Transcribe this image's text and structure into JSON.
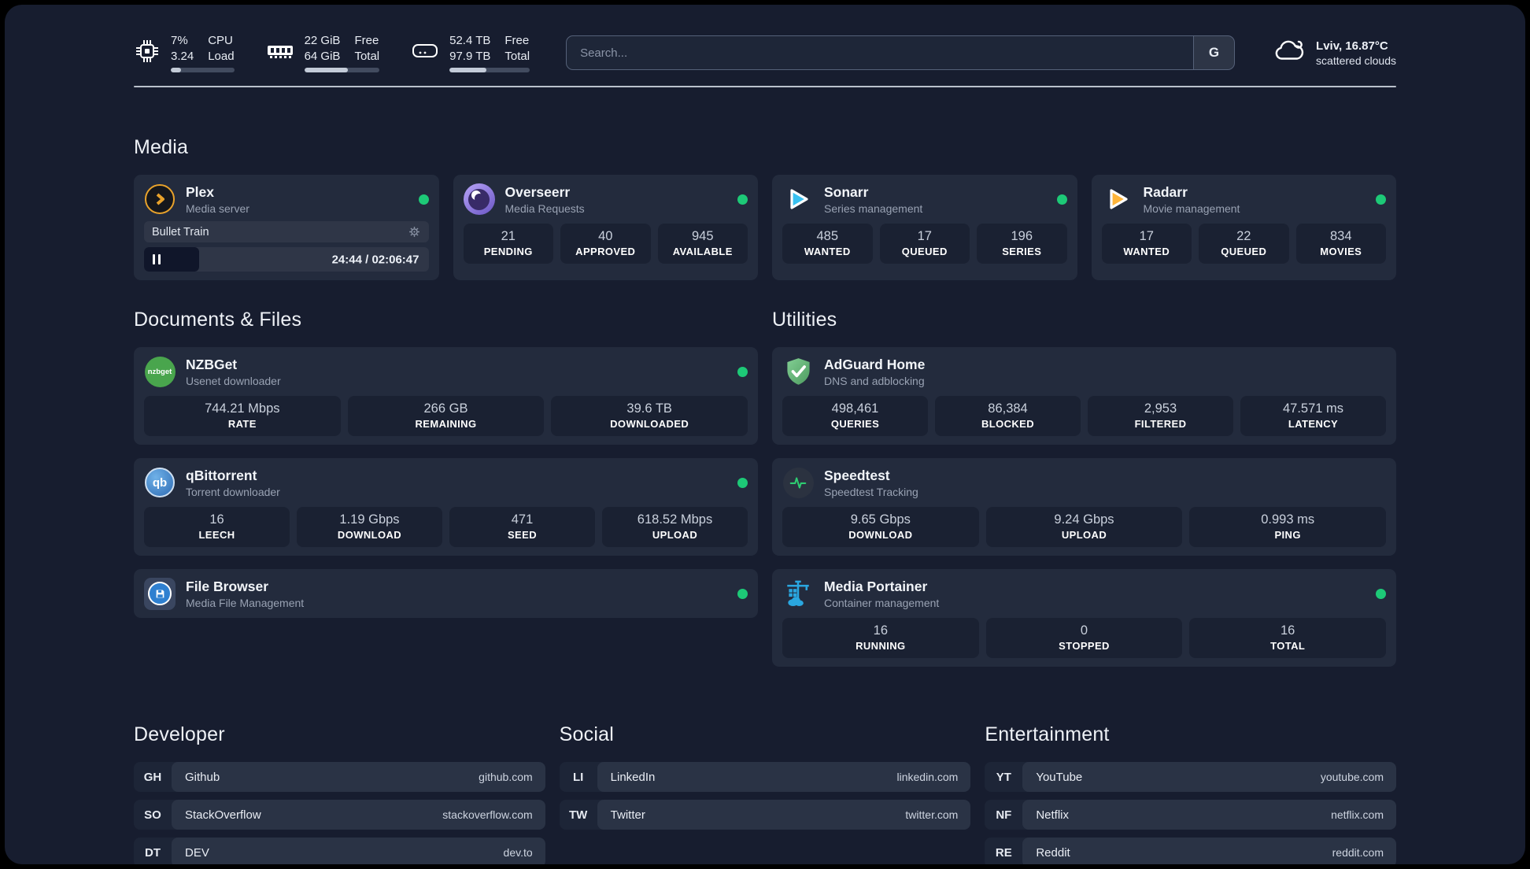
{
  "colors": {
    "page_bg": "#171d2f",
    "card_bg": "#232b3d",
    "tile_bg": "#1a2132",
    "status_green": "#1dc977",
    "plex_orange": "#e8a22b",
    "portainer_blue": "#2aa7e0"
  },
  "header": {
    "stats": [
      {
        "icon": "cpu-icon",
        "col1": [
          "7%",
          "3.24"
        ],
        "col2": [
          "CPU",
          "Load"
        ],
        "progress_pct": 16
      },
      {
        "icon": "ram-icon",
        "col1": [
          "22 GiB",
          "64 GiB"
        ],
        "col2": [
          "Free",
          "Total"
        ],
        "progress_pct": 58
      },
      {
        "icon": "disk-icon",
        "col1": [
          "52.4 TB",
          "97.9 TB"
        ],
        "col2": [
          "Free",
          "Total"
        ],
        "progress_pct": 46
      }
    ],
    "search": {
      "placeholder": "Search...",
      "button_label": "G"
    },
    "weather": {
      "icon": "cloud-icon",
      "line1": "Lviv, 16.87°C",
      "line2": "scattered clouds"
    }
  },
  "media": {
    "title": "Media",
    "plex": {
      "icon": "plex-icon",
      "name": "Plex",
      "desc": "Media server",
      "status": "online",
      "now_playing": {
        "title": "Bullet Train",
        "time": "24:44 / 02:06:47",
        "progress_pct": 19.5,
        "state": "paused"
      }
    },
    "overseerr": {
      "icon": "overseerr-icon",
      "name": "Overseerr",
      "desc": "Media Requests",
      "status": "online",
      "stats": [
        {
          "value": "21",
          "label": "PENDING"
        },
        {
          "value": "40",
          "label": "APPROVED"
        },
        {
          "value": "945",
          "label": "AVAILABLE"
        }
      ]
    },
    "sonarr": {
      "icon": "sonarr-icon",
      "name": "Sonarr",
      "desc": "Series management",
      "status": "online",
      "stats": [
        {
          "value": "485",
          "label": "WANTED"
        },
        {
          "value": "17",
          "label": "QUEUED"
        },
        {
          "value": "196",
          "label": "SERIES"
        }
      ]
    },
    "radarr": {
      "icon": "radarr-icon",
      "name": "Radarr",
      "desc": "Movie management",
      "status": "online",
      "stats": [
        {
          "value": "17",
          "label": "WANTED"
        },
        {
          "value": "22",
          "label": "QUEUED"
        },
        {
          "value": "834",
          "label": "MOVIES"
        }
      ]
    }
  },
  "documents": {
    "title": "Documents & Files",
    "nzbget": {
      "icon": "nzbget-icon",
      "name": "NZBGet",
      "desc": "Usenet downloader",
      "status": "online",
      "stats": [
        {
          "value": "744.21 Mbps",
          "label": "RATE"
        },
        {
          "value": "266 GB",
          "label": "REMAINING"
        },
        {
          "value": "39.6 TB",
          "label": "DOWNLOADED"
        }
      ]
    },
    "qbittorrent": {
      "icon": "qbittorrent-icon",
      "name": "qBittorrent",
      "desc": "Torrent downloader",
      "status": "online",
      "stats": [
        {
          "value": "16",
          "label": "LEECH"
        },
        {
          "value": "1.19 Gbps",
          "label": "DOWNLOAD"
        },
        {
          "value": "471",
          "label": "SEED"
        },
        {
          "value": "618.52 Mbps",
          "label": "UPLOAD"
        }
      ]
    },
    "filebrowser": {
      "icon": "filebrowser-icon",
      "name": "File Browser",
      "desc": "Media File Management",
      "status": "online"
    }
  },
  "utilities": {
    "title": "Utilities",
    "adguard": {
      "icon": "adguard-icon",
      "name": "AdGuard Home",
      "desc": "DNS and adblocking",
      "stats": [
        {
          "value": "498,461",
          "label": "QUERIES"
        },
        {
          "value": "86,384",
          "label": "BLOCKED"
        },
        {
          "value": "2,953",
          "label": "FILTERED"
        },
        {
          "value": "47.571 ms",
          "label": "LATENCY"
        }
      ]
    },
    "speedtest": {
      "icon": "speedtest-icon",
      "name": "Speedtest",
      "desc": "Speedtest Tracking",
      "stats": [
        {
          "value": "9.65 Gbps",
          "label": "DOWNLOAD"
        },
        {
          "value": "9.24 Gbps",
          "label": "UPLOAD"
        },
        {
          "value": "0.993 ms",
          "label": "PING"
        }
      ]
    },
    "portainer": {
      "icon": "portainer-icon",
      "name": "Media Portainer",
      "desc": "Container management",
      "status": "online",
      "stats": [
        {
          "value": "16",
          "label": "RUNNING"
        },
        {
          "value": "0",
          "label": "STOPPED"
        },
        {
          "value": "16",
          "label": "TOTAL"
        }
      ]
    }
  },
  "links": {
    "developer": {
      "title": "Developer",
      "items": [
        {
          "tag": "GH",
          "name": "Github",
          "url": "github.com"
        },
        {
          "tag": "SO",
          "name": "StackOverflow",
          "url": "stackoverflow.com"
        },
        {
          "tag": "DT",
          "name": "DEV",
          "url": "dev.to"
        }
      ]
    },
    "social": {
      "title": "Social",
      "items": [
        {
          "tag": "LI",
          "name": "LinkedIn",
          "url": "linkedin.com"
        },
        {
          "tag": "TW",
          "name": "Twitter",
          "url": "twitter.com"
        }
      ]
    },
    "entertainment": {
      "title": "Entertainment",
      "items": [
        {
          "tag": "YT",
          "name": "YouTube",
          "url": "youtube.com"
        },
        {
          "tag": "NF",
          "name": "Netflix",
          "url": "netflix.com"
        },
        {
          "tag": "RE",
          "name": "Reddit",
          "url": "reddit.com"
        }
      ]
    }
  }
}
